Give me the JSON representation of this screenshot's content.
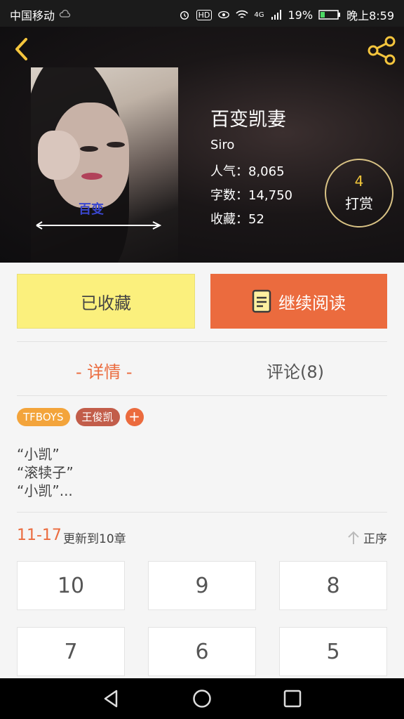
{
  "status_bar": {
    "carrier": "中国移动",
    "battery": "19%",
    "time": "晚上8:59",
    "network": "4G",
    "hd": "HD"
  },
  "book": {
    "title": "百变凯妻",
    "author": "Siro",
    "cover_text": "百变",
    "stats": [
      {
        "label": "人气：",
        "value": "8,065"
      },
      {
        "label": "字数：",
        "value": "14,750"
      },
      {
        "label": "收藏：",
        "value": "52"
      }
    ],
    "reward": {
      "count": "4",
      "label": "打赏"
    }
  },
  "actions": {
    "favorite_label": "已收藏",
    "read_label": "继续阅读"
  },
  "tabs": {
    "detail": "- 详情 -",
    "comments": "评论(8)"
  },
  "tags": [
    "TFBOYS",
    "王俊凯",
    "+"
  ],
  "description": [
    "“小凯”",
    "“滚犊子”",
    "“小凯”..."
  ],
  "update": {
    "range": "11-17",
    "text": "更新到10章",
    "sort_label": "正序"
  },
  "chapters": [
    "10",
    "9",
    "8",
    "7",
    "6",
    "5"
  ],
  "colors": {
    "accent": "#eb6b3e",
    "favorite_bg": "#fbf07d",
    "tag_orange": "#f3a43b",
    "tag_brown": "#c25d4a",
    "reward_gold": "#f2c63a"
  }
}
